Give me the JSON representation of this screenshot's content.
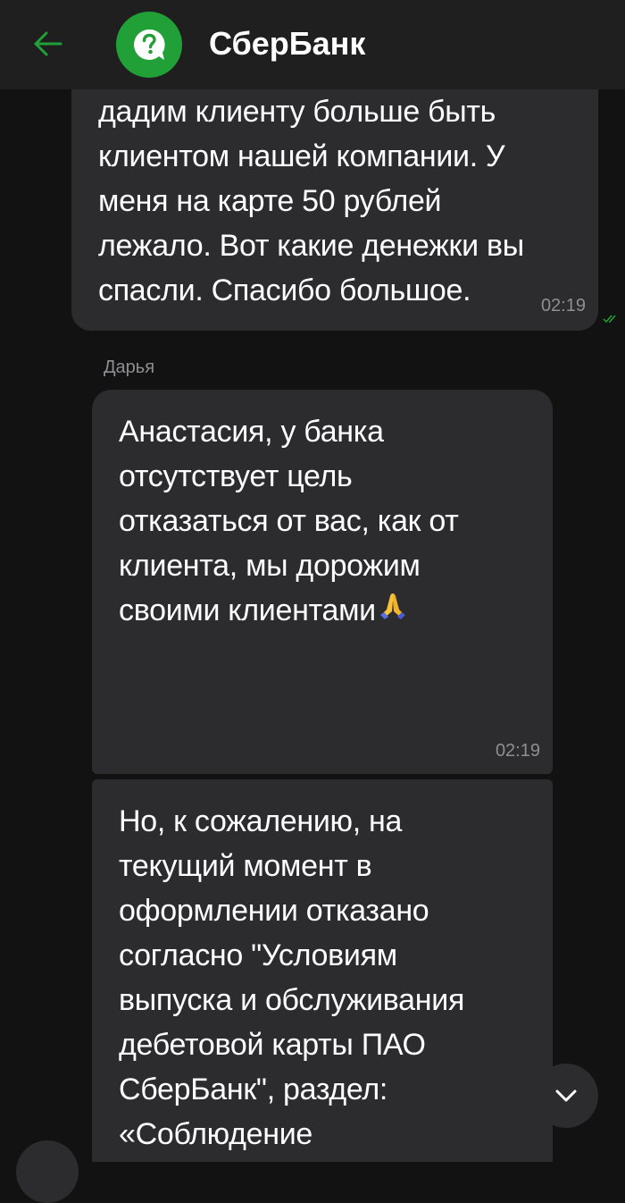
{
  "header": {
    "title": "СберБанк",
    "back_icon": "arrow-left-icon",
    "avatar_icon": "help-chat-icon",
    "accent_color": "#21a038"
  },
  "messages": {
    "outgoing": {
      "text": "дадим клиенту больше быть\nклиентом нашей компании. У\nменя на карте 50 рублей\nлежало. Вот какие денежки вы\nспасли. Спасибо большое.",
      "time": "02:19",
      "status_icon": "double-check-icon"
    },
    "sender_name": "Дарья",
    "incoming_1": {
      "text": "Анастасия, у банка\nотсутствует цель\nотказаться от вас, как от\nклиента, мы дорожим\nсвоими клиентами",
      "emoji": "folded-hands-emoji",
      "time": "02:19"
    },
    "incoming_2": {
      "text": "Но, к сожалению, на\nтекущий момент в\nоформлении отказано\nсогласно \"Условиям\nвыпуска и обслуживания\nдебетовой карты ПАО\nСберБанк\", раздел:\n«Соблюдение"
    }
  },
  "scroll_button": {
    "icon": "chevron-down-icon"
  }
}
